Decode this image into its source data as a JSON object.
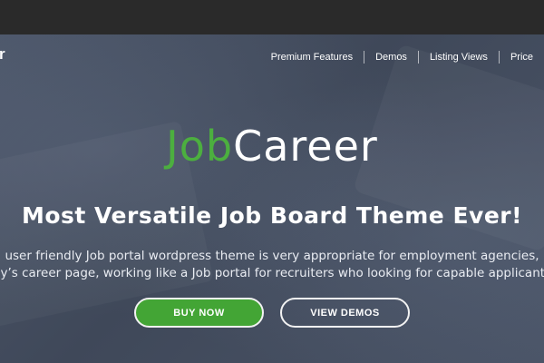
{
  "logo": {
    "partial_letter": "r"
  },
  "nav": {
    "items": [
      {
        "label": "Premium Features"
      },
      {
        "label": "Demos"
      },
      {
        "label": "Listing Views"
      },
      {
        "label": "Price"
      }
    ]
  },
  "hero": {
    "brand_part1": "Job",
    "brand_part2": "Career",
    "tagline": "Most Versatile Job Board Theme Ever!",
    "description_line1": "user friendly Job portal wordpress theme is very appropriate for employment agencies,",
    "description_line2": "ny’s career page, working like a Job portal for recruiters who looking for capable applicants",
    "buy_label": "BUY NOW",
    "view_demos_label": "VIEW DEMOS"
  },
  "colors": {
    "brand_green": "#4caf3f",
    "button_green": "#43a535",
    "hero_overlay": "#465065",
    "topbar": "#2a2a2a"
  }
}
